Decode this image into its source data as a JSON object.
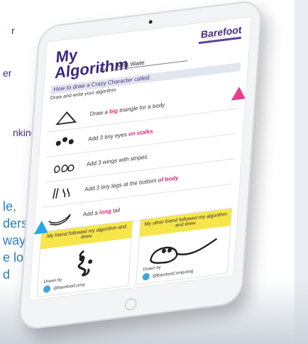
{
  "left_text": {
    "line1": "r",
    "line2": "er",
    "line3": "nking.",
    "line4": "le,",
    "line5": "derstand",
    "line6": "way and",
    "line7": "e love",
    "line8": "d"
  },
  "worksheet": {
    "brand": "Barefoot",
    "title_line1": "My",
    "title_line2": "Algorithm",
    "by_label": "by",
    "author_name": "Miss Waite",
    "ribbon": "How to draw a Crazy Character called:",
    "hint": "Draw and write your algorithm",
    "steps": [
      {
        "icon": "triangle-icon",
        "before": "Draw a ",
        "highlight": "big",
        "after": " triangle for a body"
      },
      {
        "icon": "eyes-icon",
        "before": "Add 3 tiny eyes ",
        "highlight": "on stalks",
        "after": ""
      },
      {
        "icon": "wings-icon",
        "before": "Add 3 wings with stripes",
        "highlight": "",
        "after": ""
      },
      {
        "icon": "legs-icon",
        "before": "Add 3 tiny legs at the bottom ",
        "highlight": "of body",
        "after": ""
      },
      {
        "icon": "tail-icon",
        "before": "Add a ",
        "highlight": "long",
        "after": " tail"
      }
    ],
    "footer_cards": [
      {
        "head": "My friend followed my algorithm and drew",
        "name": "Drawn by",
        "tag": "@BarefootComp"
      },
      {
        "head": "My other friend followed my algorithm and drew",
        "name": "Drawn by",
        "tag": "@BarefootComputing"
      }
    ]
  }
}
